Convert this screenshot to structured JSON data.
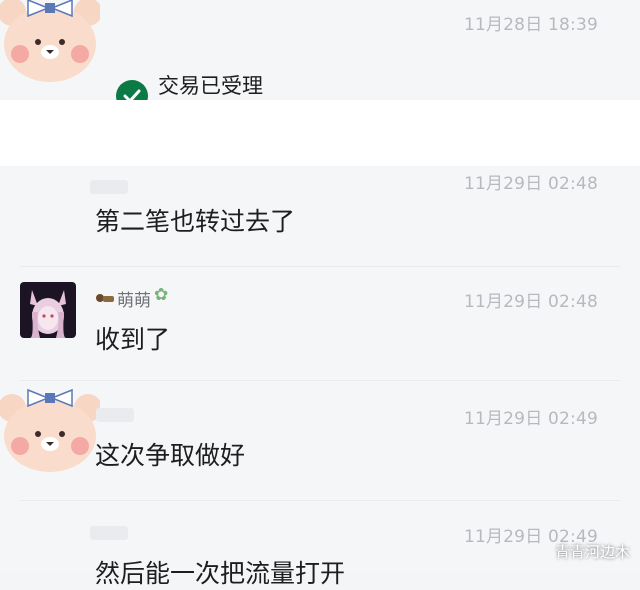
{
  "messages": [
    {
      "timestamp": "11月28日 18:39",
      "text": "交易已受理"
    },
    {
      "timestamp": "11月29日 02:48",
      "text": "第二笔也转过去了"
    },
    {
      "timestamp": "11月29日 02:48",
      "sender": "萌萌",
      "text": "收到了"
    },
    {
      "timestamp": "11月29日 02:49",
      "text": "这次争取做好"
    },
    {
      "timestamp": "11月29日 02:49",
      "text": "然后能一次把流量打开"
    }
  ],
  "watermark": "青青河边木",
  "icons": {
    "check": "check-icon",
    "bear_avatar": "bear-avatar-icon",
    "girl_avatar": "avatar-image",
    "bow": "bow-icon",
    "sender_prefix": "badge-icon",
    "sender_suffix": "fairy-icon"
  },
  "colors": {
    "check": "#0b7a45",
    "time": "#b6b9bf",
    "text": "#1e1e1e"
  }
}
